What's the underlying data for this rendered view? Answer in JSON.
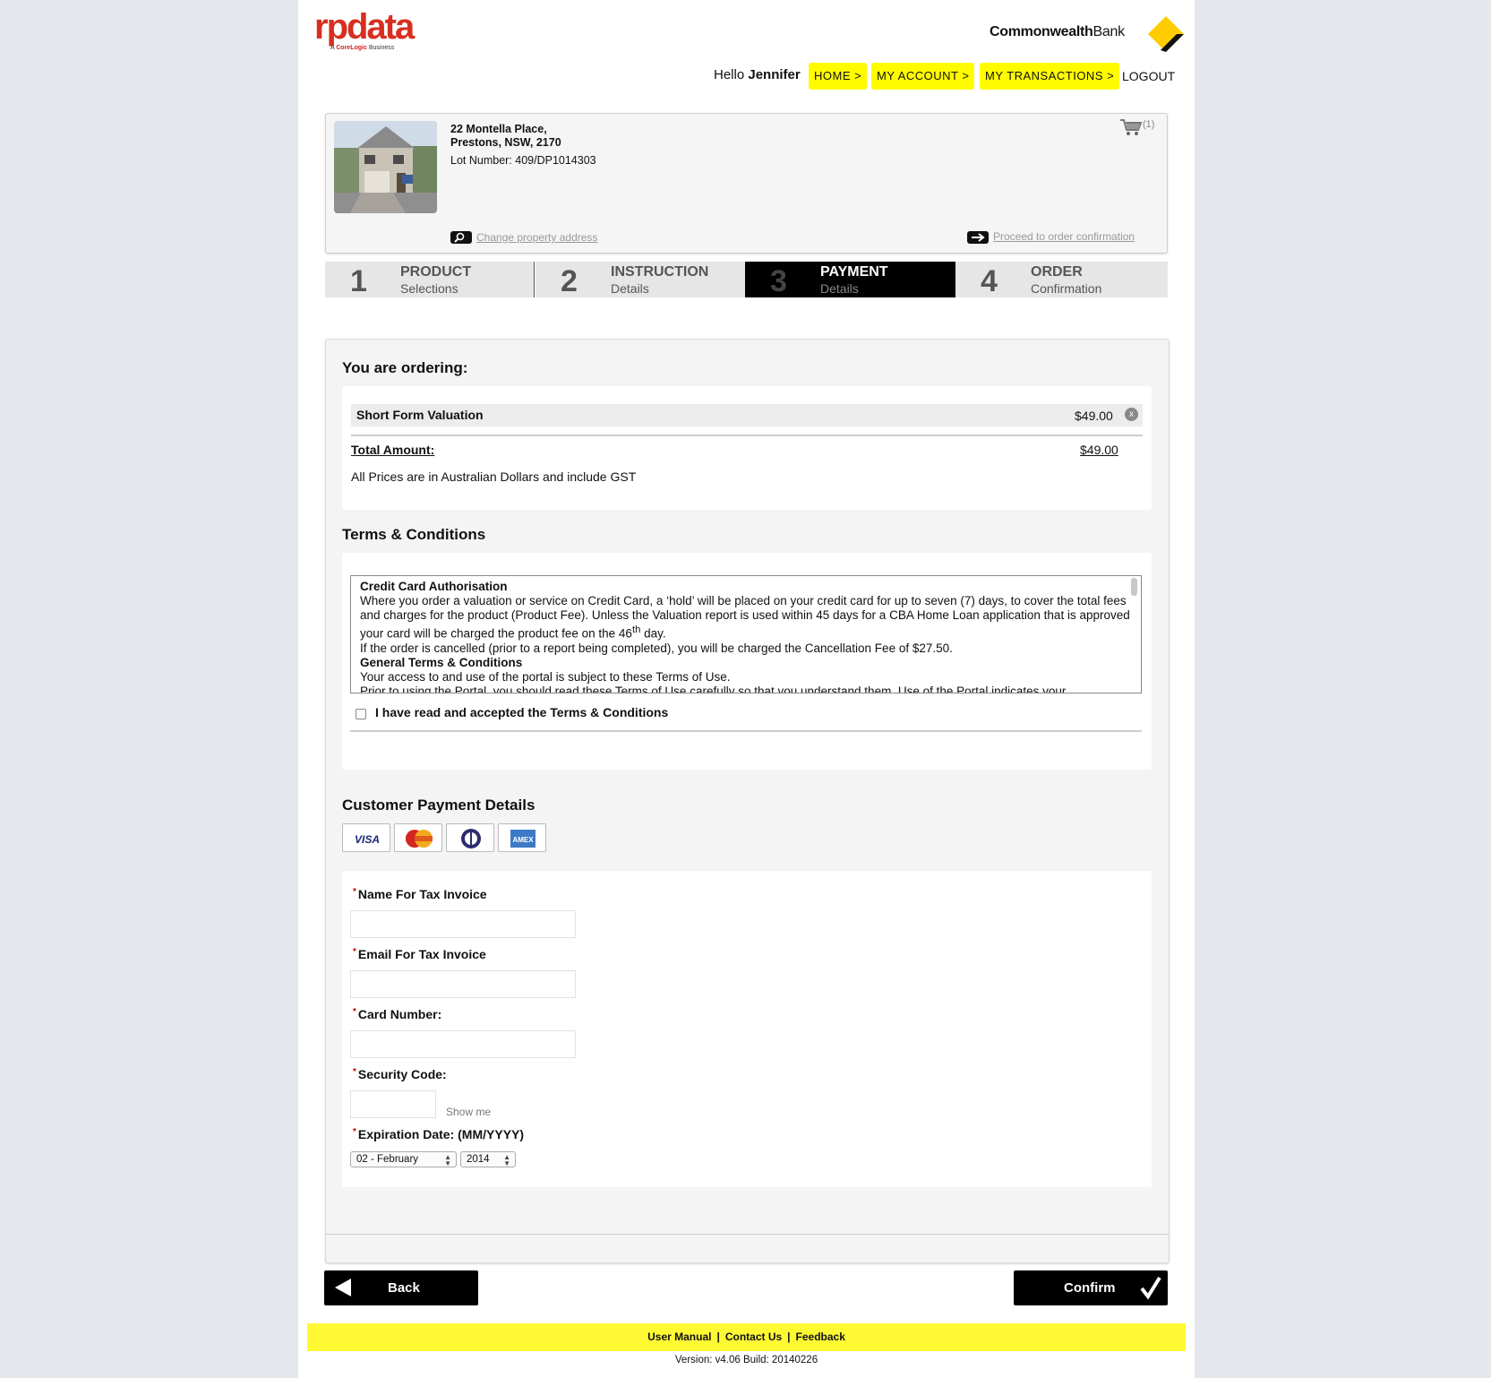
{
  "header": {
    "logo_main": "rpdata",
    "logo_sub_prefix": "A",
    "logo_sub_brand": "CoreLogic",
    "logo_sub_suffix": "Business",
    "bank_bold": "Commonwealth",
    "bank_light": "Bank",
    "greeting": "Hello",
    "user_name": "Jennifer",
    "nav": {
      "home": "HOME >",
      "account": "MY ACCOUNT >",
      "transactions": "MY TRANSACTIONS >",
      "logout": "LOGOUT"
    }
  },
  "property": {
    "address_line1": "22 Montella Place,",
    "address_line2": "Prestons, NSW, 2170",
    "lot": "Lot Number: 409/DP1014303",
    "cart_count": "(1)",
    "change_address": "Change property address",
    "proceed": "Proceed to order confirmation"
  },
  "steps": [
    {
      "num": "1",
      "title": "PRODUCT",
      "sub": "Selections"
    },
    {
      "num": "2",
      "title": "INSTRUCTION",
      "sub": "Details"
    },
    {
      "num": "3",
      "title": "PAYMENT",
      "sub": "Details"
    },
    {
      "num": "4",
      "title": "ORDER",
      "sub": "Confirmation"
    }
  ],
  "active_step": 3,
  "ordering": {
    "heading": "You are ordering:",
    "item_name": "Short Form Valuation",
    "item_price": "$49.00",
    "remove_glyph": "x",
    "total_label": "Total Amount:",
    "total_value": "$49.00",
    "note": "All Prices are in Australian Dollars and include GST"
  },
  "terms": {
    "heading": "Terms & Conditions",
    "cc_heading": "Credit Card Authorisation",
    "cc_text_1": "Where you order a valuation or service on Credit Card, a ‘hold’ will be placed on your credit card for up to seven (7) days, to cover the total fees and charges for the product (Product Fee). Unless the Valuation report is used within 45 days for a CBA Home Loan application that is approved your card will be charged the product fee on the 46",
    "cc_sup": "th",
    "cc_text_2": " day.",
    "cc_text_3": "If the order is cancelled (prior to a report being completed), you will be charged the Cancellation Fee of $27.50.",
    "general_heading": "General Terms & Conditions",
    "general_text_1": "Your access to and use of the portal is subject to these Terms of Use.",
    "general_text_2": "Prior to using the Portal, you should read these Terms of Use carefully so that you understand them. Use of the Portal indicates your",
    "accept_label": "I have read and accepted the Terms & Conditions",
    "accepted": false
  },
  "payment": {
    "heading": "Customer Payment Details",
    "cards": [
      "VISA",
      "MasterCard",
      "Diners",
      "AMEX"
    ],
    "required_mark": "*",
    "name_label": "Name For Tax Invoice",
    "name_value": "",
    "email_label": "Email For Tax Invoice",
    "email_value": "",
    "card_label": "Card Number:",
    "card_value": "",
    "security_label": "Security Code:",
    "security_value": "",
    "show_me": "Show me",
    "expiry_label": "Expiration Date: (MM/YYYY)",
    "expiry_month": "02 - February",
    "expiry_year": "2014"
  },
  "actions": {
    "back": "Back",
    "confirm": "Confirm"
  },
  "footer": {
    "links": [
      "User Manual",
      "Contact Us",
      "Feedback"
    ],
    "separator": "|",
    "version": "Version: v4.06 Build: 20140226"
  },
  "colors": {
    "nav_yellow": "#fffc00",
    "footer_yellow": "#fff934",
    "logo_red": "#d62f1f",
    "cba_yellow": "#ffcc00",
    "active_step_bg": "#000000"
  }
}
